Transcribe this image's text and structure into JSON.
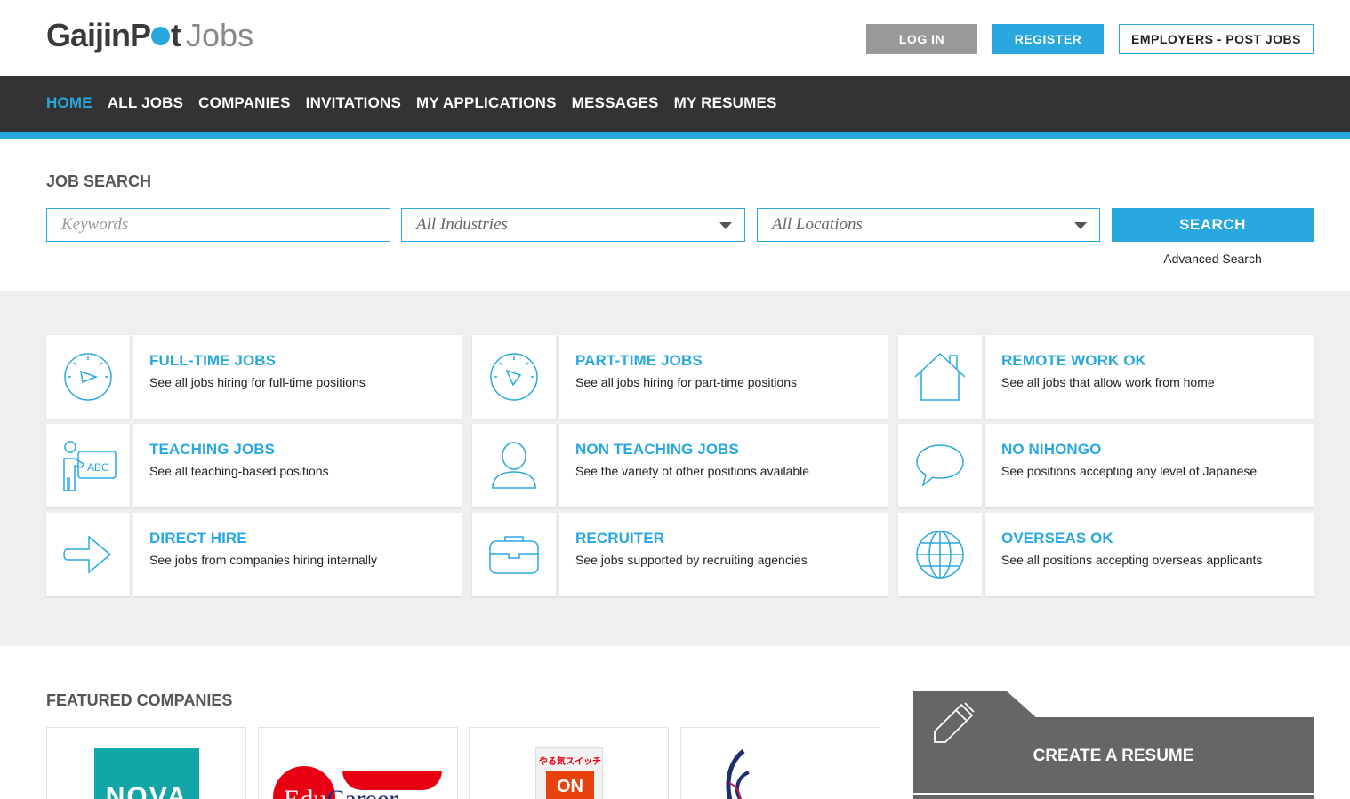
{
  "header": {
    "logo_brand_a": "GaijinP",
    "logo_brand_b": "t",
    "logo_jobs": "Jobs",
    "login_label": "LOG IN",
    "register_label": "REGISTER",
    "employers_label": "EMPLOYERS - POST JOBS"
  },
  "nav": {
    "items": [
      {
        "label": "HOME",
        "active": true
      },
      {
        "label": "ALL JOBS"
      },
      {
        "label": "COMPANIES"
      },
      {
        "label": "INVITATIONS"
      },
      {
        "label": "MY APPLICATIONS"
      },
      {
        "label": "MESSAGES"
      },
      {
        "label": "MY RESUMES"
      }
    ]
  },
  "search": {
    "title": "JOB SEARCH",
    "keywords_placeholder": "Keywords",
    "industries_value": "All Industries",
    "locations_value": "All Locations",
    "search_label": "SEARCH",
    "advanced_label": "Advanced Search"
  },
  "categories": [
    {
      "title": "FULL-TIME JOBS",
      "desc": "See all jobs hiring for full-time positions",
      "icon": "clock-full-icon"
    },
    {
      "title": "PART-TIME JOBS",
      "desc": "See all jobs hiring for part-time positions",
      "icon": "clock-part-icon"
    },
    {
      "title": "REMOTE WORK OK",
      "desc": "See all jobs that allow work from home",
      "icon": "house-icon"
    },
    {
      "title": "TEACHING JOBS",
      "desc": "See all teaching-based positions",
      "icon": "teacher-board-icon"
    },
    {
      "title": "NON TEACHING JOBS",
      "desc": "See the variety of other positions available",
      "icon": "person-icon"
    },
    {
      "title": "NO NIHONGO",
      "desc": "See positions accepting any level of Japanese",
      "icon": "speech-bubble-icon"
    },
    {
      "title": "DIRECT HIRE",
      "desc": "See jobs from companies hiring internally",
      "icon": "arrow-right-icon"
    },
    {
      "title": "RECRUITER",
      "desc": "See jobs supported by recruiting agencies",
      "icon": "briefcase-icon"
    },
    {
      "title": "OVERSEAS OK",
      "desc": "See all positions accepting overseas applicants",
      "icon": "globe-icon"
    }
  ],
  "featured": {
    "title": "FEATURED COMPANIES",
    "logos": [
      {
        "name": "nova-logo",
        "text": "NOVA"
      },
      {
        "name": "educareer-logo",
        "text_a": "Edu",
        "text_b": "Career"
      },
      {
        "name": "yaruki-switch-logo",
        "top": "やる気スイッチ",
        "on": "ON"
      },
      {
        "name": "company-emblem-logo"
      }
    ]
  },
  "resume": {
    "label": "CREATE A RESUME",
    "icon": "pen-icon"
  },
  "colors": {
    "accent": "#29a8e0",
    "nav_bg": "#333333",
    "band_bg": "#efefef",
    "resume_bg": "#666666"
  }
}
